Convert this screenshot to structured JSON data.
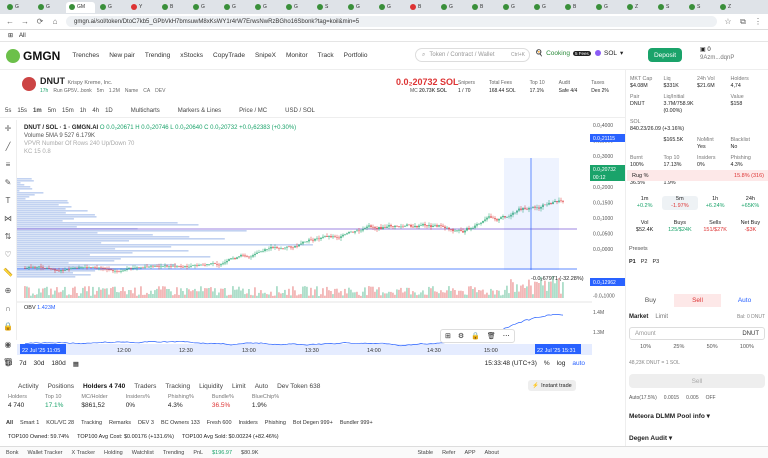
{
  "browser": {
    "tabs": [
      {
        "label": "G",
        "color": "#3a8f3a"
      },
      {
        "label": "G",
        "color": "#3a8f3a"
      },
      {
        "label": "GM",
        "color": "#3a8f3a",
        "active": true
      },
      {
        "label": "G",
        "color": "#3a8f3a"
      },
      {
        "label": "Y",
        "color": "#d33"
      },
      {
        "label": "B",
        "color": "#3a8f3a"
      },
      {
        "label": "G",
        "color": "#3a8f3a"
      },
      {
        "label": "G",
        "color": "#3a8f3a"
      },
      {
        "label": "G",
        "color": "#3a8f3a"
      },
      {
        "label": "G",
        "color": "#3a8f3a"
      },
      {
        "label": "S",
        "color": "#3a8f3a"
      },
      {
        "label": "G",
        "color": "#3a8f3a"
      },
      {
        "label": "G",
        "color": "#3a8f3a"
      },
      {
        "label": "B",
        "color": "#d33"
      },
      {
        "label": "G",
        "color": "#3a8f3a"
      },
      {
        "label": "B",
        "color": "#3a8f3a"
      },
      {
        "label": "G",
        "color": "#3a8f3a"
      },
      {
        "label": "G",
        "color": "#3a8f3a"
      },
      {
        "label": "B",
        "color": "#3a8f3a"
      },
      {
        "label": "G",
        "color": "#3a8f3a"
      },
      {
        "label": "Z",
        "color": "#3a8f3a"
      },
      {
        "label": "S",
        "color": "#3a8f3a"
      },
      {
        "label": "S",
        "color": "#3a8f3a"
      },
      {
        "label": "Z",
        "color": "#3a8f3a"
      }
    ],
    "url": "gmgn.ai/sol/token/DtoC7kb5_GPbVkH7bmsuwM8xKsWY1r4rW7ErwsNwRzBGho16Sbonk?tag=koil&min=5",
    "bookmarks_label": "All"
  },
  "header": {
    "logo": "GMGN",
    "nav": [
      "Trenches",
      "New pair",
      "Trending",
      "xStocks",
      "CopyTrade",
      "SnipeX",
      "Monitor",
      "Track",
      "Portfolio"
    ],
    "search_placeholder": "Token / Contract / Wallet",
    "search_shortcut": "Ctrl+K",
    "cooking": "Cooking",
    "cooking_badge": "5 Fees",
    "sol_label": "SOL",
    "deposit": "Deposit",
    "wallet_balance": "0",
    "wallet_addr": "9Azm...dqnP"
  },
  "token": {
    "symbol": "DNUT",
    "name": "Krispy Kreme, Inc.",
    "age": "17h",
    "sub": "Run GP5V...bonk",
    "meta": [
      "5m",
      "1.2M",
      "Name",
      "CA",
      "DEV"
    ],
    "price": "0.0₂20732 SOL",
    "mc_label": "MC",
    "mc": "20.73K SOL",
    "stats": [
      {
        "label": "Snipers",
        "value": "1 / 70"
      },
      {
        "label": "Total Fees",
        "value": "168.44 SOL"
      },
      {
        "label": "Top 10",
        "value": "17.1%"
      },
      {
        "label": "Audit",
        "value": "Safe 4/4"
      },
      {
        "label": "Taxes",
        "value": "Dex 2%"
      }
    ]
  },
  "chart_toolbar": {
    "intervals": [
      "5s",
      "15s",
      "1m",
      "5m",
      "15m",
      "1h",
      "4h",
      "1D"
    ],
    "items": [
      "Multicharts",
      "Markers & Lines",
      "Price / MC",
      "USD / SOL"
    ]
  },
  "chart_info": {
    "legend": "DNUT / SOL · 1 · GMGN.AI",
    "ohlc": "O 0.0₂20671  H 0.0₂20746  L 0.0₂20640  C 0.0₂20732  +0.0₂62383 (+0.30%)",
    "volume": "Volume 5MA 9   527  6.179K",
    "vpvr": "VPVR Number Of Rows 240 Up/Down 70",
    "indicator": "KC 15 0.8",
    "obv_label": "OBV",
    "obv_value": "1.423M",
    "measure": "-0.0₂67971 (-32.28%)",
    "time_labels": [
      "22 Jul '25  11:05",
      "12:00",
      "12:30",
      "13:00",
      "13:30",
      "14:00",
      "14:30",
      "15:00",
      "22 Jul '25  15:31"
    ],
    "price_labels": [
      "0.0₂4000",
      "0.0₂3500",
      "0.0₂3000",
      "0.0₂2500",
      "0.0₂2000",
      "0.0₂1500",
      "0.0₂1000",
      "0.0₂0500",
      "0.0₂0000",
      "0.0₂12962",
      "-0.0₂0500",
      "-0.0₂1000"
    ],
    "price_tag": "0.0₂20732",
    "price_tag2": "00:12",
    "high_tag": "0.0₂21115",
    "low_tag": "0.0₂12962",
    "obv_ticks": [
      "1.4M",
      "1.3M"
    ],
    "ranges": [
      "1d",
      "7d",
      "30d",
      "180d"
    ],
    "clock": "15:33:48 (UTC+3)",
    "log": "log",
    "auto": "auto"
  },
  "bottom": {
    "tabs": [
      "Activity",
      "Positions",
      "Holders 4 740",
      "Traders",
      "Tracking",
      "Liquidity",
      "Limit",
      "Auto",
      "Dev Token 638"
    ],
    "instant": "Instant trade",
    "holder_stats": [
      {
        "label": "Holders",
        "value": "4 740"
      },
      {
        "label": "Top 10",
        "value": "17.1%"
      },
      {
        "label": "MC/Holder",
        "value": "$861,52"
      },
      {
        "label": "Insiders%",
        "value": "0%"
      },
      {
        "label": "Phishing%",
        "value": "4.3%"
      },
      {
        "label": "Bundle%",
        "value": "36.5%"
      },
      {
        "label": "BlueChip%",
        "value": "1.9%"
      }
    ],
    "chips": [
      "All",
      "Smart 1",
      "KOL/VC 28",
      "Tracking",
      "Remarks",
      "DEV 3",
      "BC Owners 133",
      "Fresh 600",
      "Insiders",
      "Phishing",
      "Bot Degen 999+",
      "Bundler 999+"
    ],
    "top100": [
      "TOP100 Owned: 59.74%",
      "TOP100 Avg Cost: $0.00176 (+131.6%)",
      "TOP100 Avg Sold: $0.00224 (+82.46%)"
    ]
  },
  "status": [
    "Bonk",
    "Wallet Tracker",
    "X Tracker",
    "Holding",
    "Watchlist",
    "Trending",
    "PnL",
    "$196.97",
    "$80.9K",
    "Stable",
    "Refer",
    "APP",
    "About"
  ],
  "right": {
    "top": [
      {
        "l": "MKT Cap",
        "v": "$4.08M"
      },
      {
        "l": "Liq",
        "v": "$331K"
      },
      {
        "l": "24h Vol",
        "v": "$21.6M"
      },
      {
        "l": "Holders",
        "v": "4,74"
      },
      {
        "l": "Pair",
        "v": "DNUT"
      },
      {
        "l": "Liq/Initial",
        "v": "3.7M/758.9K (0.00%)"
      },
      {
        "l": "",
        "v": ""
      },
      {
        "l": "Value",
        "v": "$158"
      },
      {
        "l": "SOL",
        "v": "840.23/26.09 (+3.16%)"
      },
      {
        "l": "",
        "v": ""
      },
      {
        "l": "",
        "v": ""
      },
      {
        "l": "",
        "v": "$165.5K"
      },
      {
        "l": "NoMint",
        "v": "Yes"
      },
      {
        "l": "Blacklist",
        "v": "No"
      },
      {
        "l": "Burnt",
        "v": "100%"
      },
      {
        "l": "Top 10",
        "v": "17.13%"
      },
      {
        "l": "Insiders",
        "v": "0%"
      },
      {
        "l": "Phishing",
        "v": "4.3%"
      },
      {
        "l": "Bundler",
        "v": "36.5%"
      },
      {
        "l": "BlueChip",
        "v": "1.9%"
      }
    ],
    "rug": "Rug %",
    "rug_value": "15.8% (316)",
    "timeframes": [
      {
        "t": "1m",
        "v": "+0.2%"
      },
      {
        "t": "5m",
        "v": "-1.97%"
      },
      {
        "t": "1h",
        "v": "+6.24%"
      },
      {
        "t": "24h",
        "v": "+65K%"
      }
    ],
    "vols": [
      {
        "t": "Vol",
        "v": "$52.4K"
      },
      {
        "t": "Buys",
        "v": "125/$24K"
      },
      {
        "t": "Sells",
        "v": "151/$27K"
      },
      {
        "t": "Net Buy",
        "v": "-$3K"
      }
    ],
    "presets": "Presets",
    "preset_tabs": [
      "P1",
      "P2",
      "P3"
    ],
    "buy": "Buy",
    "sell": "Sell",
    "auto": "Auto",
    "order_types": [
      "Market",
      "Limit"
    ],
    "bal": "Bal: 0 DNUT",
    "amount_placeholder": "Amount",
    "amount_unit": "DNUT",
    "pcts": [
      "10%",
      "25%",
      "50%",
      "100%"
    ],
    "conv": "48,23K DNUT = 1 SOL",
    "sell_btn": "Sell",
    "settings": [
      "Auto(17.5%)",
      "0.0015",
      "0.005",
      "OFF"
    ],
    "pool": "Meteora DLMM Pool info",
    "degen": "Degen Audit"
  }
}
